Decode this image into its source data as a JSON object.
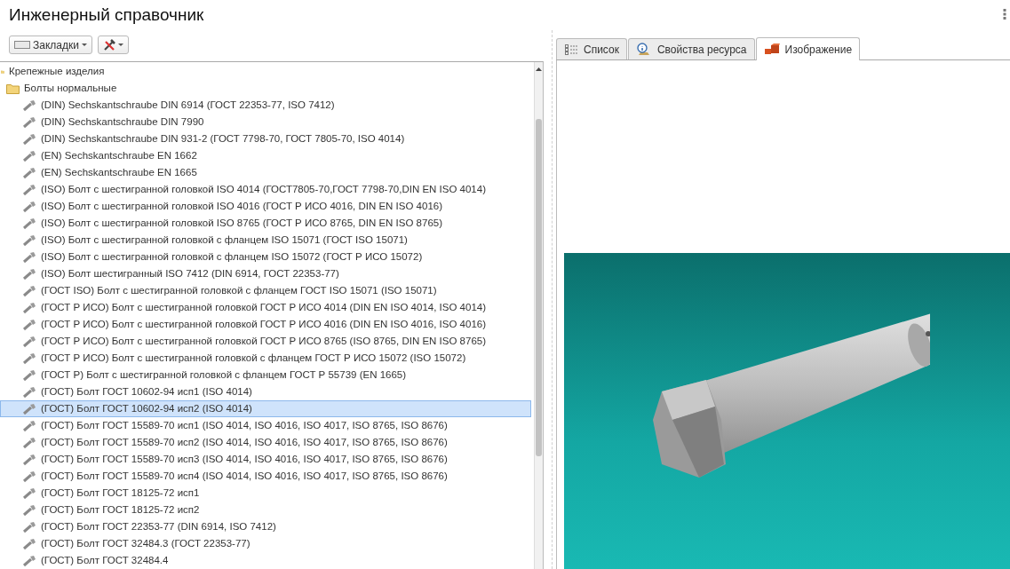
{
  "window": {
    "title": "Инженерный справочник"
  },
  "toolbar": {
    "bookmarks_button": "Закладки"
  },
  "tree": [
    {
      "label": "Крепежные изделия",
      "kind": "folder",
      "expanded": true,
      "selected": false,
      "children": [
        {
          "label": "Болты нормальные",
          "kind": "folder",
          "expanded": true,
          "selected": false,
          "children": [
            {
              "label": "(DIN) Sechskantschraube DIN 6914 (ГОСТ 22353-77, ISO 7412)",
              "kind": "item",
              "selected": false
            },
            {
              "label": "(DIN) Sechskantschraube DIN 7990",
              "kind": "item",
              "selected": false
            },
            {
              "label": "(DIN) Sechskantschraube DIN 931-2 (ГОСТ 7798-70, ГОСТ 7805-70, ISO 4014)",
              "kind": "item",
              "selected": false
            },
            {
              "label": "(EN) Sechskantschraube EN 1662",
              "kind": "item",
              "selected": false
            },
            {
              "label": "(EN) Sechskantschraube EN 1665",
              "kind": "item",
              "selected": false
            },
            {
              "label": "(ISO) Болт с шестигранной головкой ISO 4014 (ГОСТ7805-70,ГОСТ 7798-70,DIN EN ISO 4014)",
              "kind": "item",
              "selected": false
            },
            {
              "label": "(ISO) Болт с шестигранной головкой ISO 4016 (ГОСТ Р ИСО 4016, DIN EN ISO 4016)",
              "kind": "item",
              "selected": false
            },
            {
              "label": "(ISO) Болт с шестигранной головкой ISO 8765 (ГОСТ Р ИСО 8765, DIN EN ISO 8765)",
              "kind": "item",
              "selected": false
            },
            {
              "label": "(ISO) Болт с шестигранной головкой с фланцем ISO 15071 (ГОСТ ISO 15071)",
              "kind": "item",
              "selected": false
            },
            {
              "label": "(ISO) Болт с шестигранной головкой с фланцем ISO 15072 (ГОСТ Р ИСО 15072)",
              "kind": "item",
              "selected": false
            },
            {
              "label": "(ISO) Болт шестигранный ISO 7412 (DIN 6914, ГОСТ 22353-77)",
              "kind": "item",
              "selected": false
            },
            {
              "label": "(ГОСТ ISO) Болт с шестигранной головкой с фланцем ГОСТ ISO 15071 (ISO 15071)",
              "kind": "item",
              "selected": false
            },
            {
              "label": "(ГОСТ Р ИСО) Болт с шестигранной головкой ГОСТ Р ИСО 4014 (DIN EN ISO 4014, ISO 4014)",
              "kind": "item",
              "selected": false
            },
            {
              "label": "(ГОСТ Р ИСО) Болт с шестигранной головкой ГОСТ Р ИСО 4016 (DIN EN ISO 4016, ISO 4016)",
              "kind": "item",
              "selected": false
            },
            {
              "label": "(ГОСТ Р ИСО) Болт с шестигранной головкой ГОСТ Р ИСО 8765 (ISO 8765, DIN EN ISO 8765)",
              "kind": "item",
              "selected": false
            },
            {
              "label": "(ГОСТ Р ИСО) Болт с шестигранной головкой с фланцем ГОСТ Р ИСО 15072 (ISO 15072)",
              "kind": "item",
              "selected": false
            },
            {
              "label": "(ГОСТ Р) Болт с шестигранной головкой с фланцем ГОСТ Р 55739 (EN 1665)",
              "kind": "item",
              "selected": false
            },
            {
              "label": "(ГОСТ) Болт ГОСТ 10602-94 исп1 (ISO 4014)",
              "kind": "item",
              "selected": false
            },
            {
              "label": "(ГОСТ) Болт ГОСТ 10602-94 исп2 (ISO 4014)",
              "kind": "item",
              "selected": true
            },
            {
              "label": "(ГОСТ) Болт ГОСТ 15589-70 исп1 (ISO 4014, ISO 4016, ISO 4017, ISO 8765, ISO 8676)",
              "kind": "item",
              "selected": false
            },
            {
              "label": "(ГОСТ) Болт ГОСТ 15589-70 исп2 (ISO 4014, ISO 4016, ISO 4017, ISO 8765, ISO 8676)",
              "kind": "item",
              "selected": false
            },
            {
              "label": "(ГОСТ) Болт ГОСТ 15589-70 исп3 (ISO 4014, ISO 4016, ISO 4017, ISO 8765, ISO 8676)",
              "kind": "item",
              "selected": false
            },
            {
              "label": "(ГОСТ) Болт ГОСТ 15589-70 исп4 (ISO 4014, ISO 4016, ISO 4017, ISO 8765, ISO 8676)",
              "kind": "item",
              "selected": false
            },
            {
              "label": "(ГОСТ) Болт ГОСТ 18125-72 исп1",
              "kind": "item",
              "selected": false
            },
            {
              "label": "(ГОСТ) Болт ГОСТ 18125-72 исп2",
              "kind": "item",
              "selected": false
            },
            {
              "label": "(ГОСТ) Болт ГОСТ 22353-77 (DIN 6914, ISO 7412)",
              "kind": "item",
              "selected": false
            },
            {
              "label": "(ГОСТ) Болт ГОСТ 32484.3 (ГОСТ 22353-77)",
              "kind": "item",
              "selected": false
            },
            {
              "label": "(ГОСТ) Болт ГОСТ 32484.4",
              "kind": "item",
              "selected": false
            }
          ]
        }
      ]
    }
  ],
  "tabs": [
    {
      "label": "Список",
      "kind": "list",
      "selected": false
    },
    {
      "label": "Свойства ресурса",
      "kind": "info",
      "selected": false
    },
    {
      "label": "Изображение",
      "kind": "image",
      "selected": true
    }
  ]
}
